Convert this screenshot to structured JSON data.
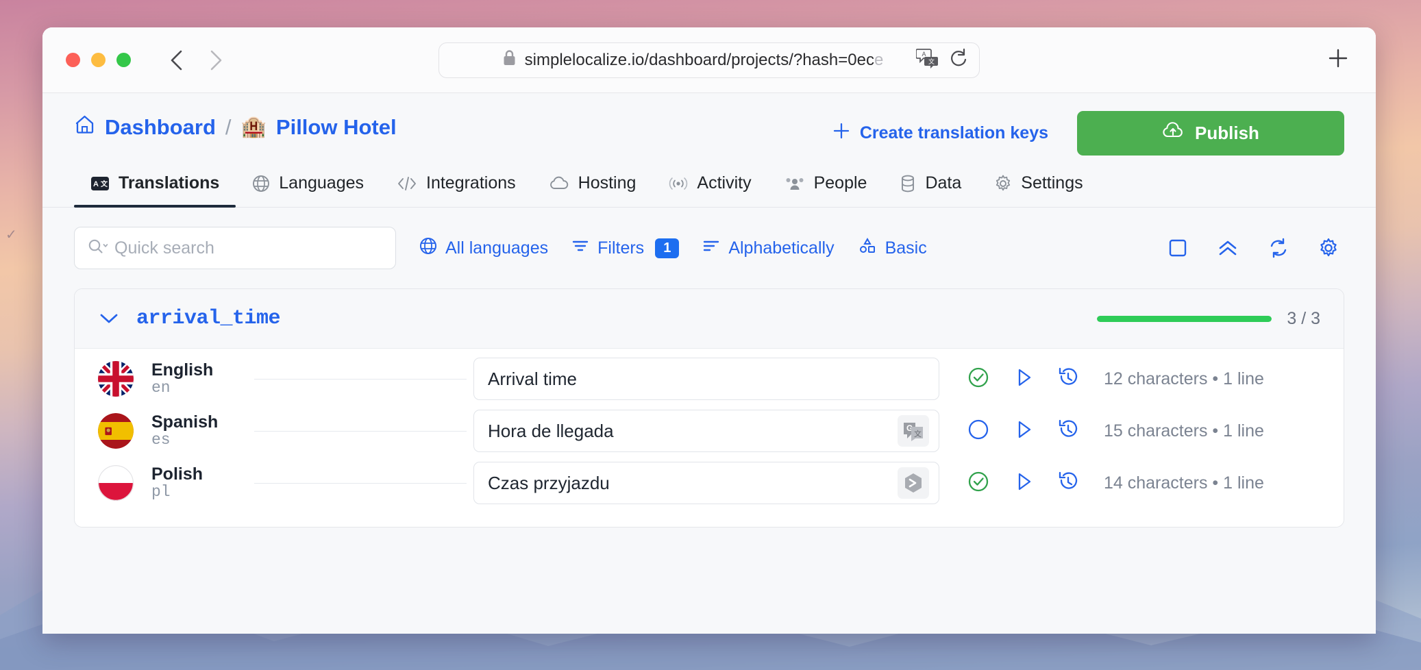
{
  "browser": {
    "url_main": "simplelocalize.io/dashboard/projects/?hash=0ec",
    "url_tail": "e",
    "translate_icon": "translate-page-icon",
    "reload_icon": "reload-icon",
    "back_icon": "back-chevron-icon",
    "forward_icon": "forward-chevron-icon",
    "newtab_icon": "new-tab-plus-icon",
    "lock_icon": "lock-icon"
  },
  "header": {
    "home_label": "Dashboard",
    "separator": "/",
    "project_emoji": "🏨",
    "project_name": "Pillow Hotel",
    "create_keys_label": "Create translation keys",
    "publish_label": "Publish"
  },
  "tabs": [
    {
      "label": "Translations",
      "icon": "translate-box-icon",
      "active": true
    },
    {
      "label": "Languages",
      "icon": "globe-icon",
      "active": false
    },
    {
      "label": "Integrations",
      "icon": "code-brackets-icon",
      "active": false
    },
    {
      "label": "Hosting",
      "icon": "cloud-icon",
      "active": false
    },
    {
      "label": "Activity",
      "icon": "broadcast-icon",
      "active": false
    },
    {
      "label": "People",
      "icon": "people-icon",
      "active": false
    },
    {
      "label": "Data",
      "icon": "database-icon",
      "active": false
    },
    {
      "label": "Settings",
      "icon": "gear-icon",
      "active": false
    }
  ],
  "toolbar": {
    "search_placeholder": "Quick search",
    "search_value": "",
    "all_languages_label": "All languages",
    "filters_label": "Filters",
    "filters_count": "1",
    "sort_label": "Alphabetically",
    "view_label": "Basic",
    "right_icons": [
      {
        "name": "select-all-checkbox-icon"
      },
      {
        "name": "collapse-all-icon"
      },
      {
        "name": "refresh-icon"
      },
      {
        "name": "settings-gear-icon"
      }
    ]
  },
  "translation_key": {
    "name": "arrival_time",
    "expanded": true,
    "progress_percent": 100,
    "ratio": "3 / 3",
    "progress_color": "#2ecc57"
  },
  "translations": [
    {
      "language": "English",
      "code": "en",
      "flag": "uk",
      "value": "Arrival time",
      "machine_translation_badge": null,
      "status": "reviewed",
      "status_icon": "check-circle-icon",
      "play_icon": "play-icon",
      "history_icon": "history-icon",
      "meta": "12 characters • 1 line"
    },
    {
      "language": "Spanish",
      "code": "es",
      "flag": "es",
      "value": "Hora de llegada",
      "machine_translation_badge": "google-translate-icon",
      "status": "not-reviewed",
      "status_icon": "empty-circle-icon",
      "play_icon": "play-icon",
      "history_icon": "history-icon",
      "meta": "15 characters • 1 line"
    },
    {
      "language": "Polish",
      "code": "pl",
      "flag": "pl",
      "value": "Czas przyjazdu",
      "machine_translation_badge": "deepl-icon",
      "status": "reviewed",
      "status_icon": "check-circle-icon",
      "play_icon": "play-icon",
      "history_icon": "history-icon",
      "meta": "14 characters • 1 line"
    }
  ],
  "colors": {
    "accent_blue": "#2563eb",
    "publish_green": "#4caf50",
    "status_green": "#2ecc57",
    "badge_blue": "#1d6ef0"
  }
}
